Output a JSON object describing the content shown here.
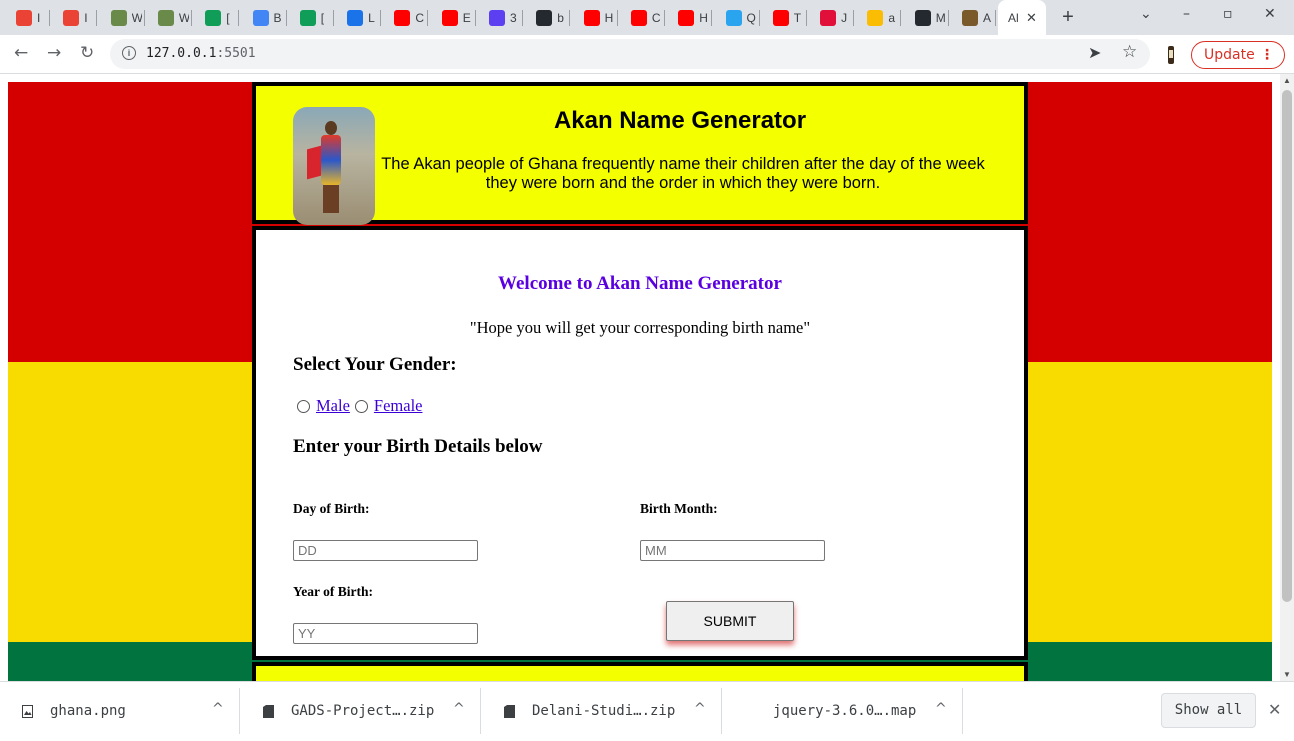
{
  "browser": {
    "tabs": [
      {
        "icon": "gmail-icon",
        "label": "I",
        "color": "#ea4335"
      },
      {
        "icon": "gmail-icon",
        "label": "I",
        "color": "#ea4335"
      },
      {
        "icon": "palm-icon",
        "label": "W",
        "color": "#6a8a4a"
      },
      {
        "icon": "palm-icon",
        "label": "W",
        "color": "#6a8a4a"
      },
      {
        "icon": "sheet-icon",
        "label": "[",
        "color": "#0f9d58"
      },
      {
        "icon": "grid-icon",
        "label": "B",
        "color": "#4285f4"
      },
      {
        "icon": "sheet-icon",
        "label": "[",
        "color": "#0f9d58"
      },
      {
        "icon": "video-icon",
        "label": "L",
        "color": "#1a73e8"
      },
      {
        "icon": "youtube-icon",
        "label": "C",
        "color": "#ff0000"
      },
      {
        "icon": "youtube-icon",
        "label": "E",
        "color": "#ff0000"
      },
      {
        "icon": "diamond-icon",
        "label": "3",
        "color": "#5b3ff0"
      },
      {
        "icon": "github-icon",
        "label": "b",
        "color": "#24292f"
      },
      {
        "icon": "youtube-icon",
        "label": "H",
        "color": "#ff0000"
      },
      {
        "icon": "youtube-icon",
        "label": "C",
        "color": "#ff0000"
      },
      {
        "icon": "youtube-icon",
        "label": "H",
        "color": "#ff0000"
      },
      {
        "icon": "skype-icon",
        "label": "Q",
        "color": "#2aa4ef"
      },
      {
        "icon": "youtube-icon",
        "label": "T",
        "color": "#ff0000"
      },
      {
        "icon": "music-icon",
        "label": "J",
        "color": "#e0103a"
      },
      {
        "icon": "drive-icon",
        "label": "a",
        "color": "#fbbc04"
      },
      {
        "icon": "github-icon",
        "label": "M",
        "color": "#24292f"
      },
      {
        "icon": "africa-icon",
        "label": "A",
        "color": "#7a5a2a"
      }
    ],
    "active_tab": {
      "label": "Al",
      "close": "✕"
    },
    "new_tab": "+",
    "window_controls": {
      "menu": "⌄",
      "minimize": "–",
      "maximize": "▫",
      "close": "✕"
    },
    "nav": {
      "back": "←",
      "forward": "→",
      "reload": "↻"
    },
    "url_host": "127.0.0.1",
    "url_port": ":5501",
    "send_icon": "➤",
    "star_icon": "☆",
    "update_label": "Update",
    "update_menu": "⋮"
  },
  "page": {
    "colors": {
      "red": "#d40000",
      "yellow": "#f8dc00",
      "green": "#00733f",
      "header_bg": "#f4ff00",
      "accent": "#5a00e0"
    },
    "header": {
      "title": "Akan Name Generator",
      "description": "The Akan people of Ghana frequently name their children after the day of the week they were born and the order in which they were born."
    },
    "welcome": "Welcome to Akan Name Generator",
    "quote": "\"Hope you will get your corresponding birth name\"",
    "gender_heading": "Select Your Gender:",
    "gender_options": [
      "Male",
      "Female"
    ],
    "birth_heading": "Enter your Birth Details below",
    "day_label": "Day of Birth:",
    "day_placeholder": "DD",
    "month_label": "Birth Month:",
    "month_placeholder": "MM",
    "year_label": "Year of Birth:",
    "year_placeholder": "YY",
    "submit_label": "SUBMIT"
  },
  "downloads": {
    "items": [
      {
        "name": "ghana.png",
        "icon": "image-file-icon"
      },
      {
        "name": "GADS-Project….zip",
        "icon": "file-icon"
      },
      {
        "name": "Delani-Studi….zip",
        "icon": "file-icon"
      },
      {
        "name": "jquery-3.6.0….map",
        "icon": "file-icon"
      }
    ],
    "chevron": "^",
    "show_all": "Show all",
    "close": "✕"
  }
}
